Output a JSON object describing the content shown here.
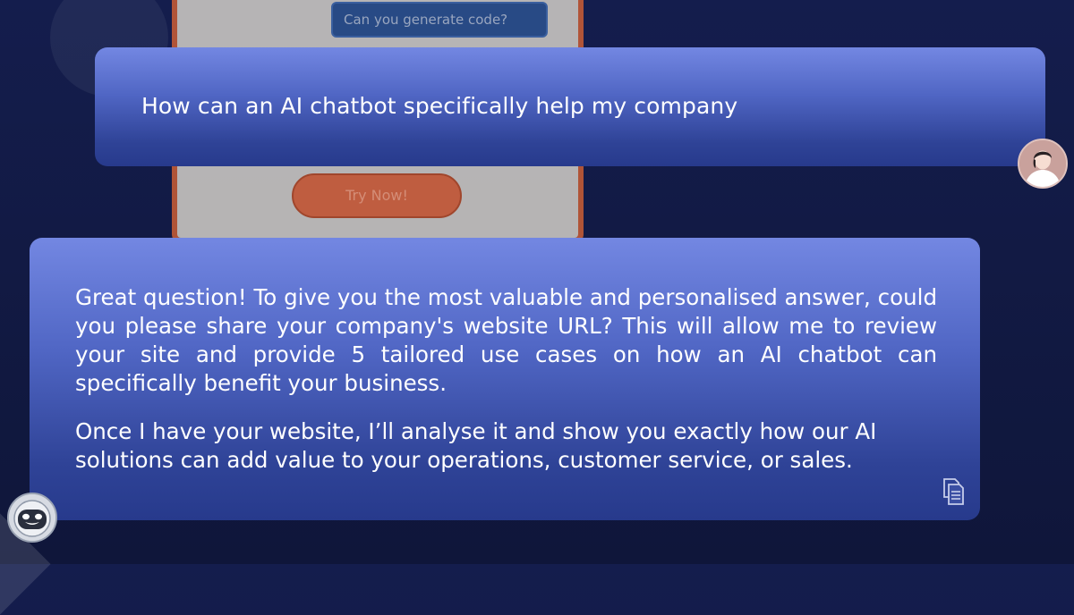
{
  "background_card": {
    "input_placeholder": "Can you generate code?",
    "try_now_label": "Try Now!"
  },
  "messages": [
    {
      "role": "user",
      "text": "How can an AI chatbot specifically help my company"
    },
    {
      "role": "assistant",
      "paragraphs": [
        "Great question! To give you the most valuable and personalised answer, could you please share your company's website URL? This will allow me to review your site and provide 5 tailored use cases on how an AI chatbot can specifically benefit your business.",
        "Once I have your website, I’ll analyse it and show you exactly how our AI solutions can add value to your operations, customer service, or sales."
      ]
    }
  ],
  "icons": {
    "copy": "copy-icon",
    "user_avatar": "user-avatar-icon",
    "bot_avatar": "robot-avatar-icon"
  },
  "colors": {
    "page_background": "#141d4d",
    "bubble_top": "#7387e2",
    "bubble_bottom": "#273a8c",
    "text": "#ffffff",
    "card_border": "#c25b36"
  }
}
